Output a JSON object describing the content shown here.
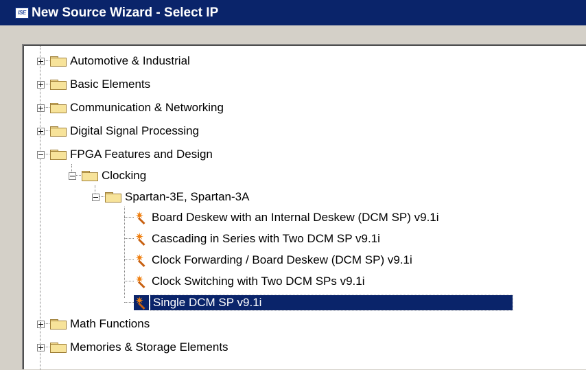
{
  "window": {
    "icon_text": "ISE",
    "title": "New Source Wizard - Select IP"
  },
  "tree": {
    "categories": [
      {
        "label": "Automotive & Industrial",
        "expanded": false
      },
      {
        "label": "Basic Elements",
        "expanded": false
      },
      {
        "label": "Communication & Networking",
        "expanded": false
      },
      {
        "label": "Digital Signal Processing",
        "expanded": false
      },
      {
        "label": "FPGA Features and Design",
        "expanded": true
      },
      {
        "label": "Math Functions",
        "expanded": false
      },
      {
        "label": "Memories & Storage Elements",
        "expanded": false
      }
    ],
    "clocking": {
      "label": "Clocking",
      "expanded": true
    },
    "family": {
      "label": "Spartan-3E, Spartan-3A",
      "expanded": true
    },
    "ip_items": [
      {
        "label": "Board Deskew with an Internal Deskew (DCM SP) v9.1i",
        "selected": false
      },
      {
        "label": "Cascading in Series with Two DCM SP v9.1i",
        "selected": false
      },
      {
        "label": "Clock Forwarding / Board Deskew (DCM SP) v9.1i",
        "selected": false
      },
      {
        "label": "Clock Switching with Two DCM SPs v9.1i",
        "selected": false
      },
      {
        "label": "Single DCM SP v9.1i",
        "selected": true
      }
    ]
  },
  "icons": {
    "folder": "folder-icon",
    "ip_core": "wizard-wand-icon",
    "expand": "plus-box-icon",
    "collapse": "minus-box-icon"
  },
  "colors": {
    "titlebar": "#0a246a",
    "selection": "#0a246a",
    "folder": "#f7e39a"
  }
}
